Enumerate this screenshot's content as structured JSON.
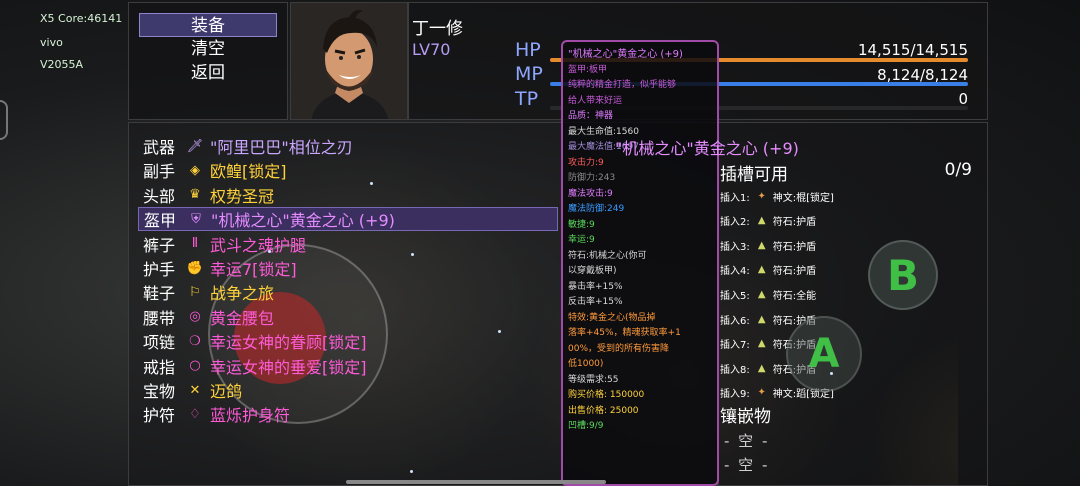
{
  "device": {
    "core": "X5 Core:46141",
    "brand": "vivo",
    "model": "V2055A"
  },
  "menu": {
    "items": [
      "装备",
      "清空",
      "返回"
    ],
    "selected": 0
  },
  "character": {
    "name": "丁一修",
    "level": "LV70"
  },
  "stats": [
    {
      "label": "HP",
      "value": "14,515/14,515",
      "fill": 1.0,
      "color": "#e68a2e"
    },
    {
      "label": "MP",
      "value": "8,124/8,124",
      "fill": 1.0,
      "color": "#3a7ee8"
    },
    {
      "label": "TP",
      "value": "0",
      "fill": 0.0,
      "color": "#a03ac8"
    }
  ],
  "equipment": [
    {
      "slot": "武器",
      "name": "\"阿里巴巴\"相位之刃",
      "color": "#c9a6ff",
      "icon": "sword-icon"
    },
    {
      "slot": "副手",
      "name": "欧鳇[锁定]",
      "color": "#ffd23a",
      "icon": "shield-icon"
    },
    {
      "slot": "头部",
      "name": "权势圣冠",
      "color": "#ffd23a",
      "icon": "crown-icon"
    },
    {
      "slot": "盔甲",
      "name": "\"机械之心\"黄金之心 (+9)",
      "color": "#e58cff",
      "icon": "armor-icon"
    },
    {
      "slot": "裤子",
      "name": "武斗之魂护腿",
      "color": "#ff5ad8",
      "icon": "pants-icon"
    },
    {
      "slot": "护手",
      "name": "幸运7[锁定]",
      "color": "#ff5ad8",
      "icon": "gauntlet-icon"
    },
    {
      "slot": "鞋子",
      "name": "战争之旅",
      "color": "#ffd23a",
      "icon": "boots-icon"
    },
    {
      "slot": "腰带",
      "name": "黄金腰包",
      "color": "#ff5ad8",
      "icon": "belt-icon"
    },
    {
      "slot": "项链",
      "name": "幸运女神的眷顾[锁定]",
      "color": "#ff5ad8",
      "icon": "necklace-icon"
    },
    {
      "slot": "戒指",
      "name": "幸运女神的垂爱[锁定]",
      "color": "#ff5ad8",
      "icon": "ring-icon"
    },
    {
      "slot": "宝物",
      "name": "迈鸽",
      "color": "#ffd23a",
      "icon": "treasure-icon"
    },
    {
      "slot": "护符",
      "name": "蓝烁护身符",
      "color": "#ff5ad8",
      "icon": "amulet-icon"
    }
  ],
  "selected_equipment": 3,
  "tooltip": {
    "title": "\"机械之心\"黄金之心 (+9)",
    "lines": [
      {
        "text": "盔甲:板甲",
        "color": "#c65ad8"
      },
      {
        "text": "纯粹的精金打造，似乎能够",
        "color": "#c65ad8"
      },
      {
        "text": "给人带来好运",
        "color": "#c65ad8"
      },
      {
        "text": "品质：神器",
        "color": "#e07bff"
      },
      {
        "text": "最大生命值:1560",
        "color": "#d8d8d8"
      },
      {
        "text": "最大魔法值:1697",
        "color": "#a08ad8"
      },
      {
        "text": "攻击力:9",
        "color": "#ff5b5b"
      },
      {
        "text": "防御力:243",
        "color": "#8a8a8a"
      },
      {
        "text": "魔法攻击:9",
        "color": "#e07bff"
      },
      {
        "text": "魔法防御:249",
        "color": "#3a9bff"
      },
      {
        "text": "敏捷:9",
        "color": "#5bd85b"
      },
      {
        "text": "幸运:9",
        "color": "#5bd85b"
      },
      {
        "text": "符石:机械之心(你可",
        "color": "#d8d8d8"
      },
      {
        "text": "以穿戴板甲)",
        "color": "#d8d8d8"
      },
      {
        "text": "暴击率+15%",
        "color": "#d8d8d8"
      },
      {
        "text": "反击率+15%",
        "color": "#d8d8d8"
      },
      {
        "text": "特效:黄金之心(物品掉",
        "color": "#ff9a3a"
      },
      {
        "text": "落率+45%，精魂获取率+1",
        "color": "#ff9a3a"
      },
      {
        "text": "00%，受到的所有伤害降",
        "color": "#ff9a3a"
      },
      {
        "text": "低1000)",
        "color": "#ff9a3a"
      },
      {
        "text": "等级需求:55",
        "color": "#d8d8d8"
      },
      {
        "text": "购买价格: 150000",
        "color": "#ffd23a"
      },
      {
        "text": "出售价格: 25000",
        "color": "#ffd23a"
      },
      {
        "text": "凹槽:9/9",
        "color": "#5bd85b"
      }
    ],
    "overlay_name": "\"机械之心\"黄金之心 (+9)"
  },
  "sockets": {
    "title": "插槽可用",
    "count": "0/9",
    "items": [
      {
        "label": "插入1:",
        "name": "神文:棍[锁定]",
        "icon": "rune-icon"
      },
      {
        "label": "插入2:",
        "name": "符石:护盾",
        "icon": "runestone-icon"
      },
      {
        "label": "插入3:",
        "name": "符石:护盾",
        "icon": "runestone-icon"
      },
      {
        "label": "插入4:",
        "name": "符石:护盾",
        "icon": "runestone-icon"
      },
      {
        "label": "插入5:",
        "name": "符石:全能",
        "icon": "runestone-icon"
      },
      {
        "label": "插入6:",
        "name": "符石:护盾",
        "icon": "runestone-icon"
      },
      {
        "label": "插入7:",
        "name": "符石:护盾",
        "icon": "runestone-icon"
      },
      {
        "label": "插入8:",
        "name": "符石:护盾",
        "icon": "runestone-icon"
      },
      {
        "label": "插入9:",
        "name": "神文:蹈[锁定]",
        "icon": "rune-icon"
      }
    ],
    "inlay_title": "镶嵌物",
    "inlay_items": [
      "- 空 -",
      "- 空 -"
    ]
  },
  "controls": {
    "b": "B",
    "a": "A"
  }
}
